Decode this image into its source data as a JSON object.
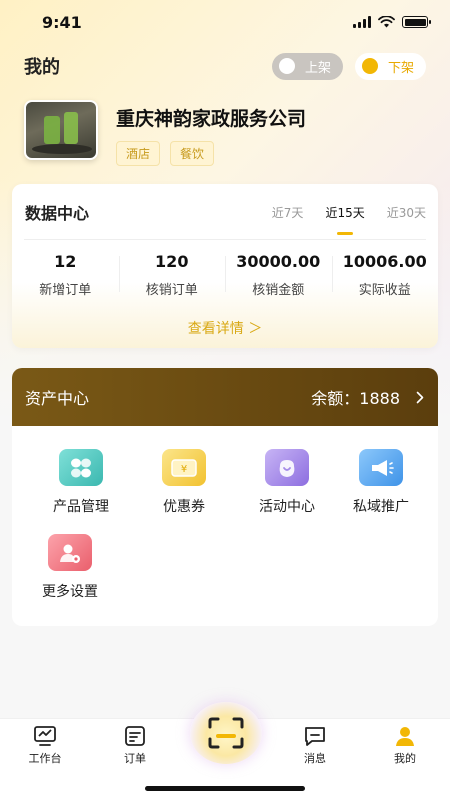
{
  "status_bar": {
    "time": "9:41"
  },
  "header": {
    "title": "我的",
    "toggle_off_label": "上架",
    "toggle_on_label": "下架"
  },
  "company": {
    "name": "重庆神韵家政服务公司",
    "tags": [
      "酒店",
      "餐饮"
    ]
  },
  "data_center": {
    "title": "数据中心",
    "ranges": [
      "近7天",
      "近15天",
      "近30天"
    ],
    "selected_range": "近15天",
    "stats": [
      {
        "value": "12",
        "label": "新增订单"
      },
      {
        "value": "120",
        "label": "核销订单"
      },
      {
        "value": "30000.00",
        "label": "核销金额"
      },
      {
        "value": "10006.00",
        "label": "实际收益"
      }
    ],
    "detail_link": "查看详情 ＞"
  },
  "asset_center": {
    "title": "资产中心",
    "balance_label": "余额：",
    "balance_value": "1888",
    "tools": [
      {
        "label": "产品管理",
        "icon": "product-grid-icon",
        "color": "#4cc6c0"
      },
      {
        "label": "优惠券",
        "icon": "coupon-ticket-icon",
        "color": "#f2c94c"
      },
      {
        "label": "活动中心",
        "icon": "activity-bag-icon",
        "color": "#a58be8"
      },
      {
        "label": "私域推广",
        "icon": "megaphone-icon",
        "color": "#5aa9f0"
      },
      {
        "label": "更多设置",
        "icon": "user-settings-icon",
        "color": "#f07b86"
      }
    ]
  },
  "tabbar": {
    "items": [
      {
        "label": "工作台",
        "icon": "workbench-chart-icon"
      },
      {
        "label": "订单",
        "icon": "order-list-icon"
      },
      {
        "label": "消息",
        "icon": "message-bubble-icon"
      },
      {
        "label": "我的",
        "icon": "profile-person-icon",
        "active_color": "#f2b705"
      }
    ],
    "center_icon": "scan-icon"
  }
}
